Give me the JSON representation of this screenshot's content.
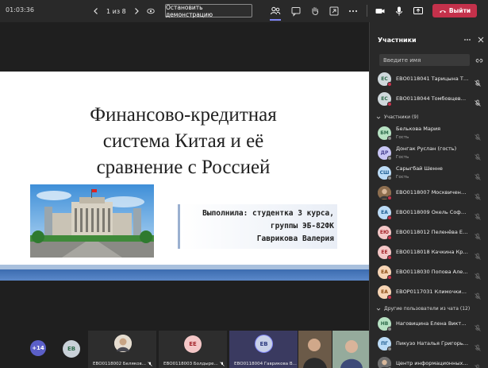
{
  "topbar": {
    "timer": "01:03:36",
    "pager": "1 из 8",
    "stop_label": "Остановить демонстрацию",
    "leave_label": "Выйти"
  },
  "slide": {
    "title_lines": [
      "Финансово-кредитная",
      "система Китая и её",
      "сравнение с Россией"
    ],
    "author_lines": [
      "Выполнила: студентка 3 курса,",
      "группы ЭБ-82ФК",
      "Гаврикова Валерия"
    ]
  },
  "bottom": {
    "more_count": "+14",
    "tiles": [
      {
        "initials": "ЕВ",
        "label": ""
      },
      {
        "initials": "",
        "label": "ЕВО0118002 Беляков..."
      },
      {
        "initials": "ЕЕ",
        "label": "ЕВО0118003 Болдыре..."
      },
      {
        "initials": "ЕВ",
        "label": "ЕВО0118004 Гаврикова В..."
      },
      {
        "initials": "",
        "label": ""
      },
      {
        "initials": "",
        "label": ""
      }
    ]
  },
  "panel": {
    "title": "Участники",
    "invite_placeholder": "Введите имя",
    "presenters": [
      {
        "initials": "ЕС",
        "name": "ЕВО0118041 Тарицына Тать...",
        "color": "#cfd8dc",
        "text_color": "#2e6b4b"
      },
      {
        "initials": "ЕС",
        "name": "ЕВО0118044 Томбовцева На...",
        "color": "#cfd8dc",
        "text_color": "#2e6b4b"
      }
    ],
    "participants_header": "Участники (9)",
    "participants": [
      {
        "initials": "БМ",
        "name": "Белькова Мария",
        "sub": "Гость",
        "color": "#b7e2c3",
        "text_color": "#2e6b4b"
      },
      {
        "initials": "ДР",
        "name": "Донгак Руслан (гость)",
        "sub": "Гость",
        "color": "#c9c6f5",
        "text_color": "#4b4694"
      },
      {
        "initials": "СШ",
        "name": "Сарыгбай Шенне",
        "sub": "Гость",
        "color": "#bcdcf7",
        "text_color": "#1f5e91"
      },
      {
        "initials": "",
        "name": "ЕВО0118007 Москвиченко Е...",
        "sub": "",
        "color": "#8d6e4f",
        "text_color": "#ffffff"
      },
      {
        "initials": "ЕА",
        "name": "ЕВО0118009 Окель Софья А...",
        "sub": "",
        "color": "#bcdcf7",
        "text_color": "#1f5e91"
      },
      {
        "initials": "ЕЮ",
        "name": "ЕВО0118012 Пеленёва Екате...",
        "sub": "",
        "color": "#f4c7c7",
        "text_color": "#a4262c"
      },
      {
        "initials": "ЕЕ",
        "name": "ЕВО0118018 Качкина Кристи...",
        "sub": "",
        "color": "#f4c7c7",
        "text_color": "#a4262c"
      },
      {
        "initials": "ЕА",
        "name": "ЕВО0118030 Попова Алекса...",
        "sub": "",
        "color": "#f7d5b5",
        "text_color": "#8a4b12"
      },
      {
        "initials": "ЕА",
        "name": "ЕВОР0117031 Климочкина А...",
        "sub": "",
        "color": "#f7d5b5",
        "text_color": "#8a4b12"
      }
    ],
    "others_header": "Другие пользователи из чата (12)",
    "others": [
      {
        "initials": "НВ",
        "name": "Наговицина Елена Викторовна",
        "color": "#b7e2c3",
        "text_color": "#2e6b4b"
      },
      {
        "initials": "ПГ",
        "name": "Пикузо Наталья Григорьевна",
        "color": "#bcdcf7",
        "text_color": "#1f5e91"
      },
      {
        "initials": "",
        "name": "Центр информационных техно...",
        "color": "#6e6e6e",
        "text_color": "#ffffff"
      }
    ]
  }
}
